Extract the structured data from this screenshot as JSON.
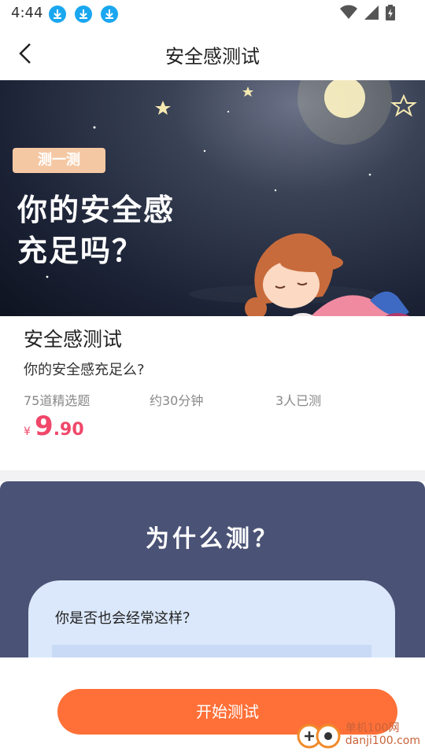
{
  "status_bar": {
    "time": "4:44",
    "download_icons": [
      "download-icon",
      "download-icon",
      "download-icon"
    ],
    "icons": [
      "wifi-icon",
      "signal-icon",
      "battery-icon"
    ]
  },
  "navbar": {
    "title": "安全感测试",
    "back_icon": "chevron-left-icon"
  },
  "banner": {
    "tag": "测一测",
    "line1": "你的安全感",
    "line2": "充足吗？"
  },
  "info": {
    "title": "安全感测试",
    "subtitle": "你的安全感充足么?",
    "meta": [
      "75道精选题",
      "约30分钟",
      "3人已测"
    ],
    "price": {
      "currency": "¥",
      "integer": "9",
      "decimal": ".90",
      "color": "#f0476a"
    }
  },
  "why": {
    "title": "为什么测？",
    "question": "你是否也会经常这样？",
    "bg_color": "#4a5275"
  },
  "bottom": {
    "start_label": "开始测试",
    "button_color": "#ff7038",
    "watermark_line1": "单机100网",
    "watermark_line2": "danji100.com"
  }
}
